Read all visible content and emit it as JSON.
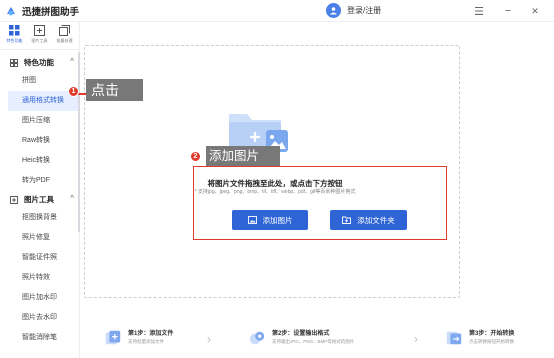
{
  "app": {
    "title": "迅捷拼图助手",
    "user_label": "登录/注册"
  },
  "window_controls": {
    "menu": "☰",
    "minimize": "−",
    "close": "✕"
  },
  "mode_tabs": [
    {
      "label": "特色功能"
    },
    {
      "label": "图片工具"
    },
    {
      "label": "批量处理"
    }
  ],
  "sidebar": {
    "section1": {
      "title": "特色功能",
      "items": [
        "拼图",
        "通用格式转换",
        "图片压缩",
        "Raw转换",
        "Heic转换",
        "转为PDF"
      ]
    },
    "section2": {
      "title": "图片工具",
      "items": [
        "抠图换背景",
        "照片修复",
        "智能证件照",
        "照片特效",
        "图片加水印",
        "图片去水印",
        "智能消除笔"
      ]
    }
  },
  "dropzone": {
    "title": "将图片文件拖拽至此处，或点击下方按钮",
    "hint": "* 支持jpg、jpeg、png、bmp、tif、tiff、webp、pdf、gif等百余种图片格式",
    "add_image_label": "添加图片",
    "add_folder_label": "添加文件夹"
  },
  "steps": [
    {
      "title": "第1步：添加文件",
      "sub": "支持批量添加文件"
    },
    {
      "title": "第2步：设置输出格式",
      "sub": "支持输出JPG、PNG、BMP等格式的图片"
    },
    {
      "title": "第3步：开始转换",
      "sub": "点击转换按钮开始转换"
    }
  ],
  "annotations": {
    "callout1": {
      "number": "1",
      "text": "点击"
    },
    "callout2": {
      "number": "2",
      "text": "添加图片"
    }
  },
  "colors": {
    "accent": "#2f64d6",
    "highlight": "#e03b2d",
    "callout_bg": "#787878"
  }
}
